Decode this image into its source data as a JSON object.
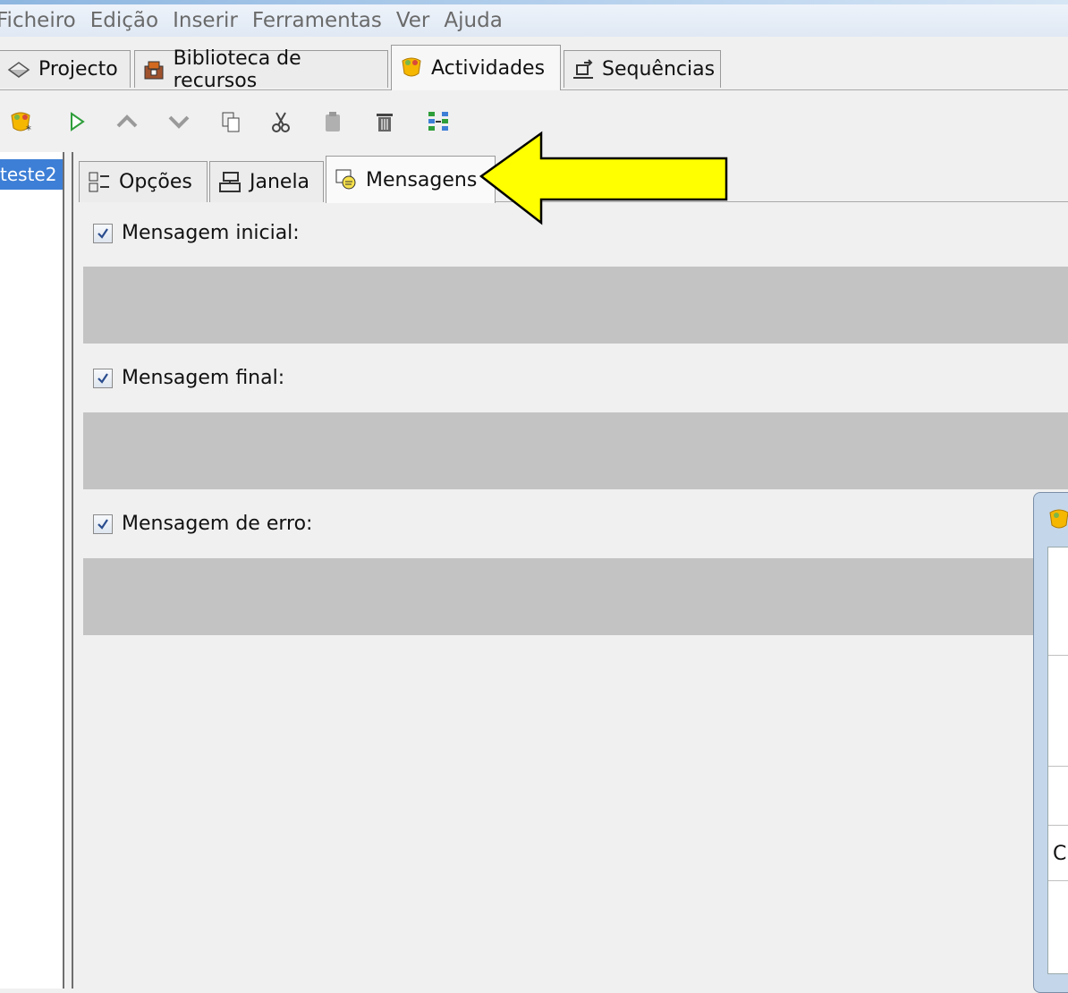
{
  "menu": [
    "Ficheiro",
    "Edição",
    "Inserir",
    "Ferramentas",
    "Ver",
    "Ajuda"
  ],
  "main_tabs": [
    {
      "label": "Projecto",
      "icon": "diamond-icon"
    },
    {
      "label": "Biblioteca de recursos",
      "icon": "resources-icon"
    },
    {
      "label": "Actividades",
      "icon": "activities-icon",
      "active": true
    },
    {
      "label": "Sequências",
      "icon": "sequences-icon"
    }
  ],
  "toolbar": [
    "new-activity-icon",
    "play-icon",
    "move-up-icon",
    "move-down-icon",
    "copy-icon",
    "cut-icon",
    "paste-icon",
    "delete-icon",
    "arrange-icon"
  ],
  "activity_list": {
    "items": [
      "teste2"
    ]
  },
  "inner_tabs": [
    {
      "label": "Opções",
      "icon": "options-icon"
    },
    {
      "label": "Janela",
      "icon": "window-icon"
    },
    {
      "label": "Mensagens",
      "icon": "messages-icon",
      "active": true
    }
  ],
  "messages": {
    "initial": {
      "label": "Mensagem inicial:",
      "checked": true
    },
    "final": {
      "label": "Mensagem final:",
      "checked": true
    },
    "error": {
      "label": "Mensagem de erro:",
      "checked": true
    }
  },
  "dialog": {
    "visible_letter": "C"
  },
  "colors": {
    "selection": "#3d7fd6",
    "arrow_fill": "#ffff00",
    "message_area": "#c3c3c3"
  }
}
